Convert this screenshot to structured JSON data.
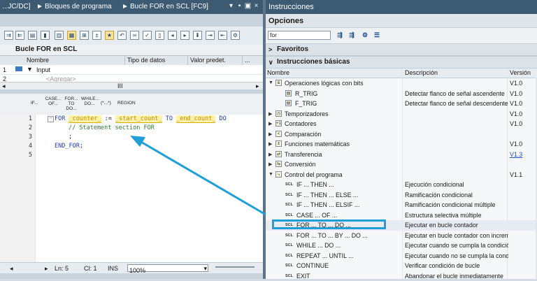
{
  "left_panel": {
    "title_parts": [
      "...JC/DC]",
      "Bloques de programa",
      "Bucle FOR en SCL [FC9]"
    ],
    "window_controls": [
      "▾",
      "▪",
      "▣",
      "×"
    ],
    "block_title": "Bucle FOR en SCL",
    "interface_columns": [
      "Nombre",
      "Tipo de datos",
      "Valor predet."
    ],
    "interface_rows": [
      {
        "num": "1",
        "name": "Input"
      },
      {
        "num": "2",
        "name": "<Agregar>"
      }
    ],
    "scroll_label": "III",
    "statement_buttons": [
      "IF...",
      "CASE... OF...",
      "FOR... TO DO...",
      "WHILE... DO...",
      "(*...*)",
      "REGION"
    ],
    "line_numbers": [
      "1",
      "2",
      "3",
      "4",
      "5"
    ],
    "code": {
      "for_kw": "FOR",
      "counter": "_counter_",
      "assign": ":=",
      "start": "_start_count_",
      "to_kw": "TO",
      "end": "_end_count_",
      "do_kw": "DO",
      "comment": "// Statement section FOR",
      "semicolon": ";",
      "end_for": "END_FOR;"
    },
    "status": {
      "ln": "Ln: 5",
      "cl": "Cl: 1",
      "mode": "INS",
      "zoom": "100%"
    }
  },
  "right_panel": {
    "title": "Instrucciones",
    "options_label": "Opciones",
    "search_value": "for",
    "favoritos": "Favoritos",
    "basicas": "Instrucciones básicas",
    "columns": [
      "Nombre",
      "Descripción",
      "Versión"
    ],
    "rows": [
      {
        "name": "Operaciones lógicas con bits",
        "desc": "",
        "ver": "V1.0",
        "level": 0,
        "expanded": true,
        "icon": "bits-icon"
      },
      {
        "name": "R_TRIG",
        "desc": "Detectar flanco de señal ascendente",
        "ver": "V1.0",
        "level": 1,
        "icon": "trig-icon"
      },
      {
        "name": "F_TRIG",
        "desc": "Detectar flanco de señal descendente",
        "ver": "V1.0",
        "level": 1,
        "icon": "trig-icon"
      },
      {
        "name": "Temporizadores",
        "desc": "",
        "ver": "V1.0",
        "level": 0,
        "expanded": false,
        "icon": "timer-icon"
      },
      {
        "name": "Contadores",
        "desc": "",
        "ver": "V1.0",
        "level": 0,
        "expanded": false,
        "icon": "counter-icon"
      },
      {
        "name": "Comparación",
        "desc": "",
        "ver": "",
        "level": 0,
        "expanded": false,
        "icon": "compare-icon"
      },
      {
        "name": "Funciones matemáticas",
        "desc": "",
        "ver": "V1.0",
        "level": 0,
        "expanded": false,
        "icon": "math-icon"
      },
      {
        "name": "Transferencia",
        "desc": "",
        "ver": "V1.3",
        "level": 0,
        "expanded": false,
        "icon": "move-icon",
        "link": true
      },
      {
        "name": "Conversión",
        "desc": "",
        "ver": "",
        "level": 0,
        "expanded": false,
        "icon": "convert-icon"
      },
      {
        "name": "Control del programa",
        "desc": "",
        "ver": "V1.1",
        "level": 0,
        "expanded": true,
        "icon": "program-icon"
      },
      {
        "name": "IF ... THEN ...",
        "desc": "Ejecución condicional",
        "ver": "",
        "level": 1,
        "scl": true
      },
      {
        "name": "IF ... THEN ... ELSE ...",
        "desc": "Ramificación condicional",
        "ver": "",
        "level": 1,
        "scl": true
      },
      {
        "name": "IF ... THEN ... ELSIF ...",
        "desc": "Ramificación condicional múltiple",
        "ver": "",
        "level": 1,
        "scl": true
      },
      {
        "name": "CASE ... OF ...",
        "desc": "Estructura selectiva múltiple",
        "ver": "",
        "level": 1,
        "scl": true
      },
      {
        "name": "FOR ... TO ... DO ...",
        "desc": "Ejecutar en bucle contador",
        "ver": "",
        "level": 1,
        "scl": true,
        "highlight": true
      },
      {
        "name": "FOR ... TO ... BY ... DO ...",
        "desc": "Ejecutar en bucle contador con incremento",
        "ver": "",
        "level": 1,
        "scl": true
      },
      {
        "name": "WHILE ... DO ...",
        "desc": "Ejecutar cuando se cumpla la condición",
        "ver": "",
        "level": 1,
        "scl": true
      },
      {
        "name": "REPEAT ... UNTIL ...",
        "desc": "Ejecutar cuando no se cumpla la condición",
        "ver": "",
        "level": 1,
        "scl": true
      },
      {
        "name": "CONTINUE",
        "desc": "Verificar condición de bucle",
        "ver": "",
        "level": 1,
        "scl": true
      },
      {
        "name": "EXIT",
        "desc": "Abandonar el bucle inmediatamente",
        "ver": "",
        "level": 1,
        "scl": true
      }
    ]
  },
  "colors": {
    "title_bar": "#3d5a73",
    "highlight_box": "#1f9ed8",
    "arrow": "#1f9ed8",
    "keyword": "#1b3cc8",
    "comment": "#2e7d32"
  }
}
